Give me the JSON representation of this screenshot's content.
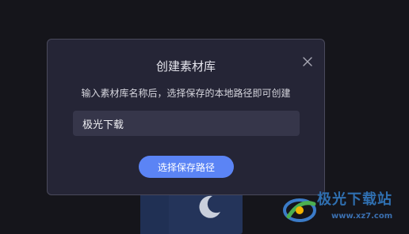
{
  "dialog": {
    "title": "创建素材库",
    "subtitle": "输入素材库名称后，选择保存的本地路径即可创建",
    "name_input_value": "极光下载",
    "choose_path_label": "选择保存路径"
  },
  "watermark": {
    "name": "极光下载站",
    "url": "www.xz7.com"
  },
  "colors": {
    "background": "#15151b",
    "dialog": "#252536",
    "input": "#36364a",
    "accent": "#5b84f5"
  },
  "icons": {
    "close": "close-icon",
    "moon": "moon-icon",
    "logo": "watermark-logo-icon"
  }
}
